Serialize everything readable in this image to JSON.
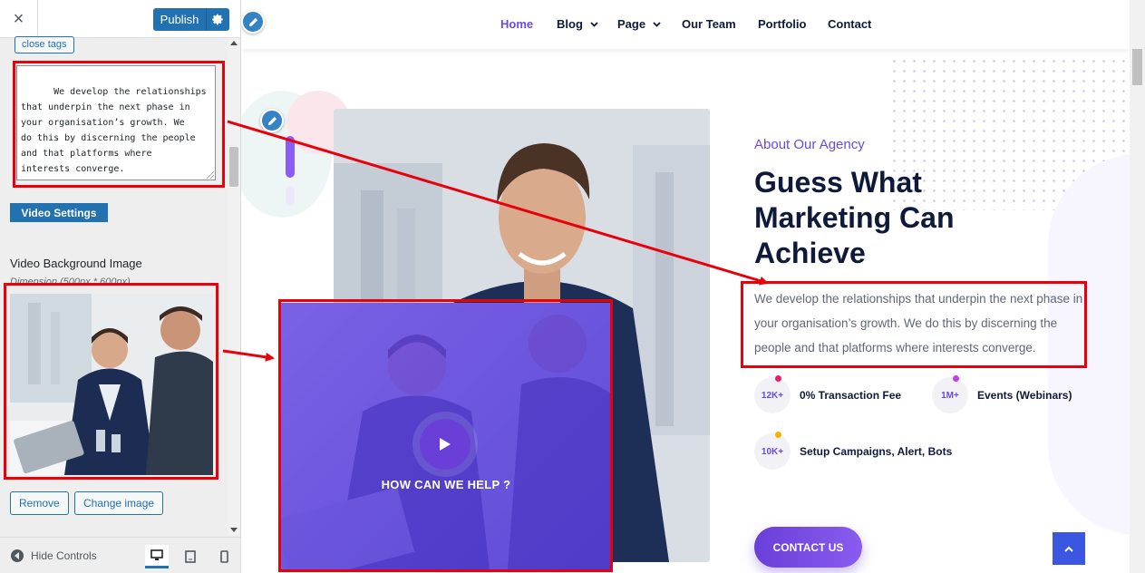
{
  "sidebar": {
    "close_icon": "×",
    "publish_label": "Publish",
    "close_tags_label": "close tags",
    "textarea_value": "We develop the relationships\nthat underpin the next phase in\nyour organisation’s growth. We\ndo this by discerning the people\nand that platforms where\ninterests converge.",
    "video_settings_label": "Video Settings",
    "video_bg_label": "Video Background Image",
    "video_bg_dimension": "Dimension (500px * 600px)",
    "remove_label": "Remove",
    "change_image_label": "Change image",
    "hide_controls_label": "Hide Controls"
  },
  "nav": {
    "items": [
      {
        "label": "Home",
        "active": true,
        "dropdown": false
      },
      {
        "label": "Blog",
        "active": false,
        "dropdown": true
      },
      {
        "label": "Page",
        "active": false,
        "dropdown": true
      },
      {
        "label": "Our Team",
        "active": false,
        "dropdown": false
      },
      {
        "label": "Portfolio",
        "active": false,
        "dropdown": false
      },
      {
        "label": "Contact",
        "active": false,
        "dropdown": false
      }
    ]
  },
  "about": {
    "kicker": "About Our Agency",
    "headline": "Guess What Marketing Can Achieve",
    "body": "We develop the relationships that underpin the next phase in your organisation’s growth. We do this by discerning the people and that platforms where interests converge.",
    "video_caption": "HOW CAN WE HELP ?",
    "stats": [
      {
        "value": "12K+",
        "label": "0% Transaction Fee",
        "dot_color": "#ec1c6e"
      },
      {
        "value": "1M+",
        "label": "Events (Webinars)",
        "dot_color": "#c13ff0"
      },
      {
        "value": "10K+",
        "label": "Setup Campaigns, Alert, Bots",
        "dot_color": "#f5b300"
      }
    ],
    "contact_label": "CONTACT US"
  },
  "colors": {
    "accent": "#6a4bdc",
    "wp_blue": "#2271b1",
    "annotation_red": "#e8000b"
  }
}
